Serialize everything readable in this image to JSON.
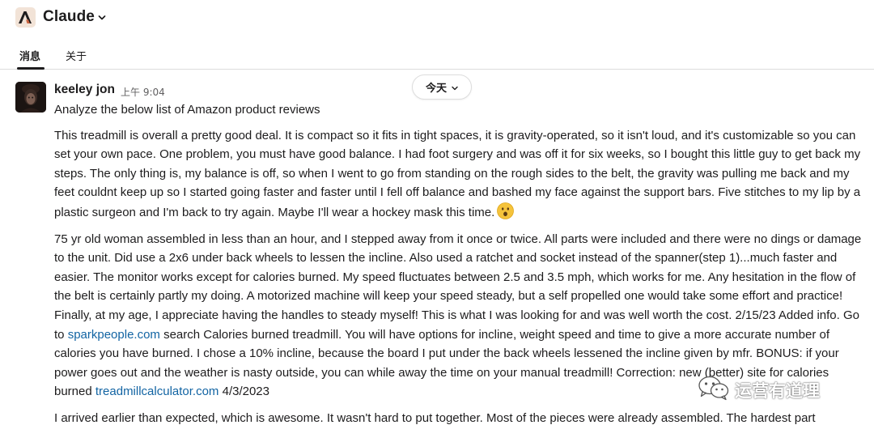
{
  "app": {
    "title": "Claude",
    "logo_letter": "A"
  },
  "tabs": [
    {
      "label": "消息",
      "active": true
    },
    {
      "label": "关于",
      "active": false
    }
  ],
  "date_divider": {
    "label": "今天"
  },
  "message": {
    "sender": "keeley jon",
    "time": "上午 9:04",
    "prompt": "Analyze the below list of Amazon product reviews",
    "review1": "This treadmill is overall a pretty good deal. It is compact so it fits in tight spaces, it is gravity-operated, so it isn't loud, and it's customizable so you can set your own pace. One problem, you must have good balance. I had foot surgery and was off it for six weeks, so I bought this little guy to get back my steps. The only thing is, my balance is off, so when I went to go from standing on the rough sides to the belt, the gravity was pulling me back and my feet couldnt keep up so I started going faster and faster until I fell off balance and bashed my face against the support bars. Five stitches to my lip by a plastic surgeon and I'm back to try again. Maybe I'll wear a hockey mask this time.",
    "review1_emoji": "hushed-face-emoji",
    "review2_part1": "75 yr old woman assembled in less than an hour, and I stepped away from it once or twice. All parts were included and there were no dings or damage to the unit. Did use a 2x6 under back wheels to lessen the incline. Also used a ratchet and socket instead of the spanner(step 1)...much faster and easier. The monitor works except for calories burned. My speed fluctuates between 2.5 and 3.5 mph, which works for me. Any hesitation in the flow of the belt is certainly partly my doing. A motorized machine will keep your speed steady, but a self propelled one would take some effort and practice! Finally, at my age, I appreciate having the handles to steady myself! This is what I was looking for and was well worth the cost. 2/15/23 Added info. Go to ",
    "review2_link1": "sparkpeople.com",
    "review2_part2": " search Calories burned treadmill. You will have options for incline, weight speed and time to give a more accurate number of calories you have burned. I chose a 10% incline, because the board I put under the back wheels lessened the incline given by mfr. BONUS: if your power goes out and the weather is nasty outside, you can while away the time on your manual treadmill! Correction: new (better) site for calories burned ",
    "review2_link2": "treadmillcalculator.com",
    "review2_part3": " 4/3/2023",
    "review3": "I arrived earlier than expected, which is awesome. It wasn't hard to put together. Most of the pieces were already assembled. The hardest part"
  },
  "watermark": {
    "text": "运营有道理",
    "icon": "wechat-icon"
  },
  "colors": {
    "link": "#1264a3",
    "text": "#1d1c1d",
    "muted": "#616061",
    "logo_bg": "#f2e3d7",
    "logo_fg": "#c96442"
  }
}
